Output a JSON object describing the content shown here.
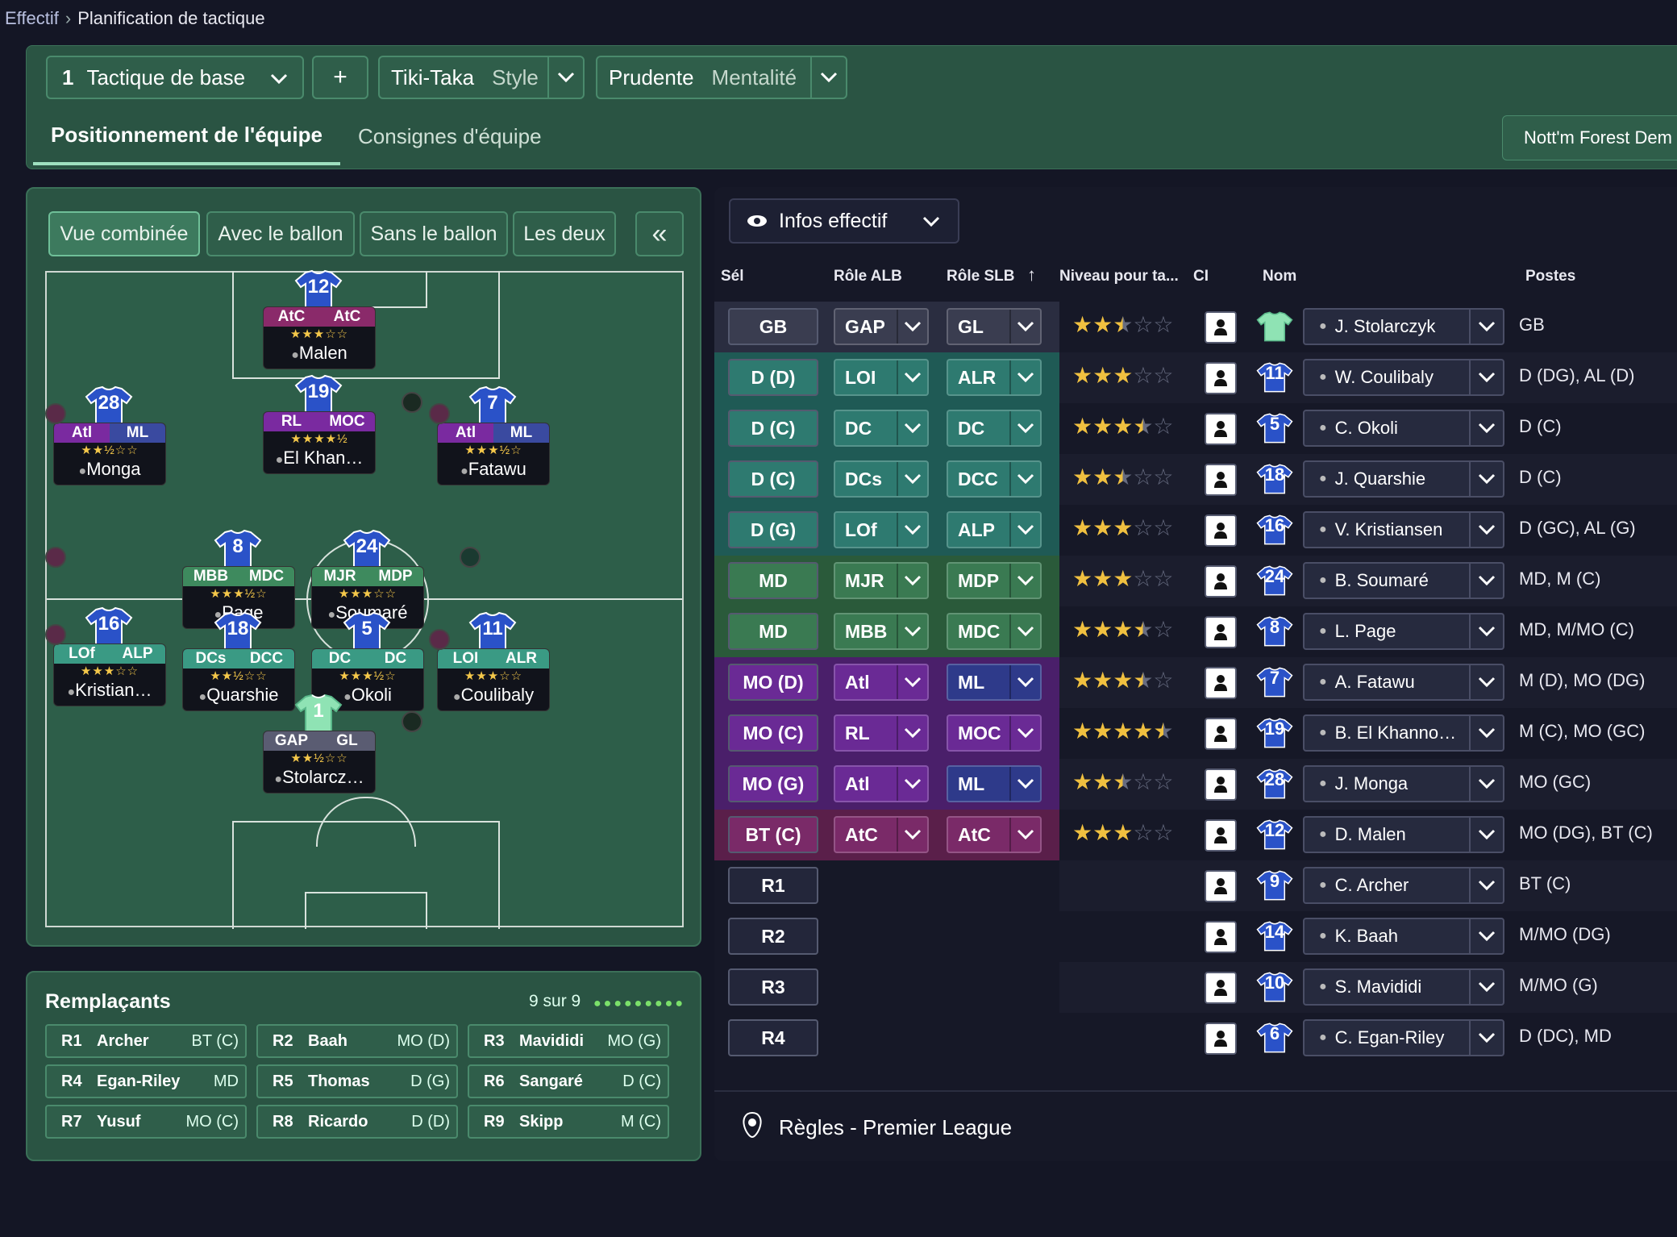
{
  "breadcrumb": {
    "root": "Effectif",
    "current": "Planification de tactique"
  },
  "tactic": {
    "number": "1",
    "name": "Tactique de base",
    "add": "+",
    "style_value": "Tiki-Taka",
    "style_label": "Style",
    "mentality_value": "Prudente",
    "mentality_label": "Mentalité"
  },
  "tabs": {
    "positioning": "Positionnement de l'équipe",
    "instructions": "Consignes d'équipe"
  },
  "opponent": "Nott'm Forest   Dem",
  "views": {
    "combined": "Vue combinée",
    "with_ball": "Avec le ballon",
    "without_ball": "Sans le ballon",
    "both": "Les deux",
    "collapse": "«"
  },
  "pitch_players": [
    {
      "num": "12",
      "r1": "AtC",
      "r2": "AtC",
      "stars": "★★★☆☆",
      "name": "Malen",
      "color": "#8a2a6a",
      "c2": "#8a2a6a"
    },
    {
      "num": "19",
      "r1": "RL",
      "r2": "MOC",
      "stars": "★★★★½",
      "name": "El Khan…",
      "color": "#7a2aa0",
      "c2": "#7a2aa0"
    },
    {
      "num": "28",
      "r1": "Atl",
      "r2": "ML",
      "stars": "★★½☆☆",
      "name": "Monga",
      "color": "#7a2aa0",
      "c2": "#3a4aa0"
    },
    {
      "num": "7",
      "r1": "Atl",
      "r2": "ML",
      "stars": "★★★½☆",
      "name": "Fatawu",
      "color": "#7a2aa0",
      "c2": "#3a4aa0"
    },
    {
      "num": "8",
      "r1": "MBB",
      "r2": "MDC",
      "stars": "★★★½☆",
      "name": "Page",
      "color": "#3e8a5e",
      "c2": "#3e8a5e"
    },
    {
      "num": "24",
      "r1": "MJR",
      "r2": "MDP",
      "stars": "★★★☆☆",
      "name": "Soumaré",
      "color": "#3e8a5e",
      "c2": "#3e8a5e"
    },
    {
      "num": "16",
      "r1": "LOf",
      "r2": "ALP",
      "stars": "★★★☆☆",
      "name": "Kristian…",
      "color": "#3a9a84",
      "c2": "#3a9a84"
    },
    {
      "num": "18",
      "r1": "DCs",
      "r2": "DCC",
      "stars": "★★½☆☆",
      "name": "Quarshie",
      "color": "#3a9a84",
      "c2": "#3a9a84"
    },
    {
      "num": "5",
      "r1": "DC",
      "r2": "DC",
      "stars": "★★★½☆",
      "name": "Okoli",
      "color": "#3a9a84",
      "c2": "#3a9a84"
    },
    {
      "num": "11",
      "r1": "LOI",
      "r2": "ALR",
      "stars": "★★★☆☆",
      "name": "Coulibaly",
      "color": "#3a9a84",
      "c2": "#3a9a84"
    },
    {
      "num": "1",
      "r1": "GAP",
      "r2": "GL",
      "stars": "★★½☆☆",
      "name": "Stolarcz…",
      "color": "#5a5c72",
      "c2": "#5a5c72"
    }
  ],
  "subs": {
    "title": "Remplaçants",
    "count": "9 sur 9",
    "dots": "●●●●●●●●●",
    "items": [
      {
        "slot": "R1",
        "name": "Archer",
        "pos": "BT (C)"
      },
      {
        "slot": "R2",
        "name": "Baah",
        "pos": "MO (D)"
      },
      {
        "slot": "R3",
        "name": "Mavididi",
        "pos": "MO (G)"
      },
      {
        "slot": "R4",
        "name": "Egan-Riley",
        "pos": "MD"
      },
      {
        "slot": "R5",
        "name": "Thomas",
        "pos": "D (G)"
      },
      {
        "slot": "R6",
        "name": "Sangaré",
        "pos": "D (C)"
      },
      {
        "slot": "R7",
        "name": "Yusuf",
        "pos": "MO (C)"
      },
      {
        "slot": "R8",
        "name": "Ricardo",
        "pos": "D (D)"
      },
      {
        "slot": "R9",
        "name": "Skipp",
        "pos": "M (C)"
      }
    ]
  },
  "table": {
    "info_button": "Infos effectif",
    "headers": {
      "sel": "Sél",
      "alb": "Rôle ALB",
      "slb": "Rôle SLB",
      "level": "Niveau pour ta...",
      "ci": "CI",
      "name": "Nom",
      "postes": "Postes"
    },
    "rows": [
      {
        "sel": "GB",
        "alb": "GAP",
        "slb": "GL",
        "stars": 2.5,
        "num": "",
        "name": "J. Stolarczyk",
        "postes": "GB",
        "band": "#2a2d40",
        "selc": "#3a3d50",
        "gk": true
      },
      {
        "sel": "D (D)",
        "alb": "LOI",
        "slb": "ALR",
        "stars": 3,
        "num": "11",
        "name": "W. Coulibaly",
        "postes": "D (DG), AL (D)",
        "band": "#1f5a55",
        "selc": "#2e7a70"
      },
      {
        "sel": "D (C)",
        "alb": "DC",
        "slb": "DC",
        "stars": 3.5,
        "num": "5",
        "name": "C. Okoli",
        "postes": "D (C)",
        "band": "#1f5a55",
        "selc": "#2e7a70"
      },
      {
        "sel": "D (C)",
        "alb": "DCs",
        "slb": "DCC",
        "stars": 2.5,
        "num": "18",
        "name": "J. Quarshie",
        "postes": "D (C)",
        "band": "#1f5a55",
        "selc": "#2e7a70"
      },
      {
        "sel": "D (G)",
        "alb": "LOf",
        "slb": "ALP",
        "stars": 3,
        "num": "16",
        "name": "V. Kristiansen",
        "postes": "D (GC), AL (G)",
        "band": "#1f5a55",
        "selc": "#2e7a70"
      },
      {
        "sel": "MD",
        "alb": "MJR",
        "slb": "MDP",
        "stars": 3,
        "num": "24",
        "name": "B. Soumaré",
        "postes": "MD, M (C)",
        "band": "#2a5a3a",
        "selc": "#3a7a52"
      },
      {
        "sel": "MD",
        "alb": "MBB",
        "slb": "MDC",
        "stars": 3.5,
        "num": "8",
        "name": "L. Page",
        "postes": "MD, M/MO (C)",
        "band": "#2a5a3a",
        "selc": "#3a7a52"
      },
      {
        "sel": "MO (D)",
        "alb": "Atl",
        "slb": "ML",
        "stars": 3.5,
        "num": "7",
        "name": "A. Fatawu",
        "postes": "M (D), MO (DG)",
        "band": "#4a1f6a",
        "selc": "#6a2a95",
        "slbc": "#2e3a8a"
      },
      {
        "sel": "MO (C)",
        "alb": "RL",
        "slb": "MOC",
        "stars": 4.5,
        "num": "19",
        "name": "B. El Khanno…",
        "postes": "M (C), MO (GC)",
        "band": "#4a1f6a",
        "selc": "#6a2a95",
        "slbc": "#6a2a95"
      },
      {
        "sel": "MO (G)",
        "alb": "Atl",
        "slb": "ML",
        "stars": 2.5,
        "num": "28",
        "name": "J. Monga",
        "postes": "MO (GC)",
        "band": "#4a1f6a",
        "selc": "#6a2a95",
        "slbc": "#2e3a8a"
      },
      {
        "sel": "BT (C)",
        "alb": "AtC",
        "slb": "AtC",
        "stars": 3,
        "num": "12",
        "name": "D. Malen",
        "postes": "MO (DG), BT (C)",
        "band": "#5a1f4a",
        "selc": "#7a2a68"
      },
      {
        "sel": "R1",
        "num": "9",
        "name": "C. Archer",
        "postes": "BT (C)"
      },
      {
        "sel": "R2",
        "num": "14",
        "name": "K. Baah",
        "postes": "M/MO (DG)"
      },
      {
        "sel": "R3",
        "num": "10",
        "name": "S. Mavididi",
        "postes": "M/MO (G)"
      },
      {
        "sel": "R4",
        "num": "6",
        "name": "C. Egan-Riley",
        "postes": "D (DC), MD"
      }
    ],
    "rules": "Règles - Premier League"
  }
}
